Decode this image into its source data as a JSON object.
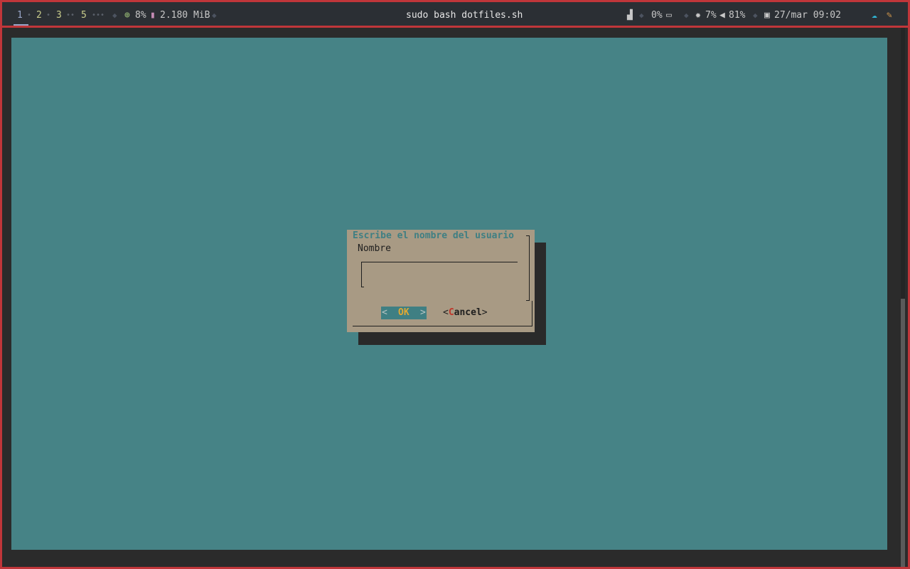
{
  "topbar": {
    "workspaces": [
      "1",
      "2",
      "3",
      "5"
    ],
    "cpu": "8%",
    "memory": "2.180 MiB",
    "title": "sudo bash dotfiles.sh",
    "network": "0%",
    "brightness": "7%",
    "volume": "81%",
    "datetime": "27/mar 09:02"
  },
  "dialog": {
    "title": "Escribe el nombre del usuario",
    "label": "Nombre",
    "input_value": "",
    "ok_label": "OK",
    "ok_left": "<",
    "ok_right": ">",
    "cancel_hotkey": "C",
    "cancel_rest": "ancel",
    "cancel_open": "<",
    "cancel_close": ">"
  },
  "colors": {
    "background": "#468386",
    "dialog": "#a89a84",
    "accent": "#e0a933",
    "hotkey": "#c0362a",
    "border": "#c0363a"
  }
}
